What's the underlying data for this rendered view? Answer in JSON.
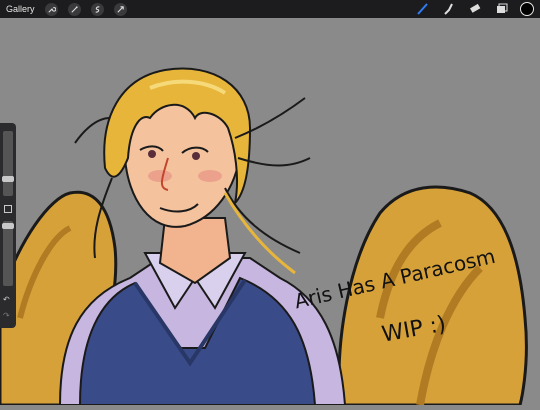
{
  "topbar": {
    "gallery_label": "Gallery",
    "left_tools": [
      "wrench-icon",
      "magic-wand-icon",
      "selection-icon",
      "transform-arrow-icon"
    ],
    "right_tools": [
      "brush-icon",
      "smudge-icon",
      "eraser-icon",
      "layers-icon"
    ],
    "current_color": "#000000"
  },
  "canvas": {
    "background": "#8a8a8a",
    "caption_line1": "Aris Has A Paracosm",
    "caption_line2": "WIP :)"
  },
  "sidebar": {
    "tools": [
      "brush-size-slider",
      "modify-square",
      "opacity-slider",
      "undo-icon",
      "redo-icon"
    ]
  }
}
